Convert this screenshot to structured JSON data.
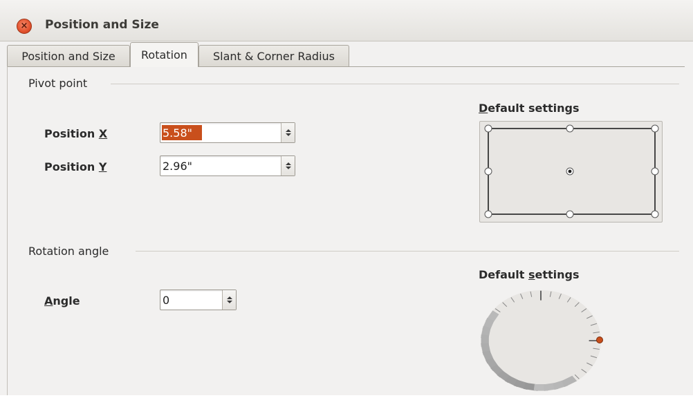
{
  "window": {
    "title": "Position and Size"
  },
  "tabs": [
    {
      "label": "Position and Size",
      "active": false
    },
    {
      "label": "Rotation",
      "active": true
    },
    {
      "label": "Slant & Corner Radius",
      "active": false
    }
  ],
  "pivot": {
    "section_title": "Pivot point",
    "position_x": {
      "label_prefix": "Position ",
      "label_mnemonic": "X",
      "value": "5.58\""
    },
    "position_y": {
      "label_prefix": "Position ",
      "label_mnemonic": "Y",
      "value": "2.96\""
    },
    "default_settings": {
      "mnemonic": "D",
      "rest": "efault settings"
    },
    "selected_point": "center"
  },
  "rotation": {
    "section_title": "Rotation angle",
    "angle": {
      "label_mnemonic": "A",
      "label_rest": "ngle",
      "value": "0"
    },
    "default_settings": {
      "before": "Default ",
      "mnemonic": "s",
      "after": "ettings"
    }
  },
  "colors": {
    "accent": "#c94f1c",
    "close_button": "#e2512d"
  }
}
